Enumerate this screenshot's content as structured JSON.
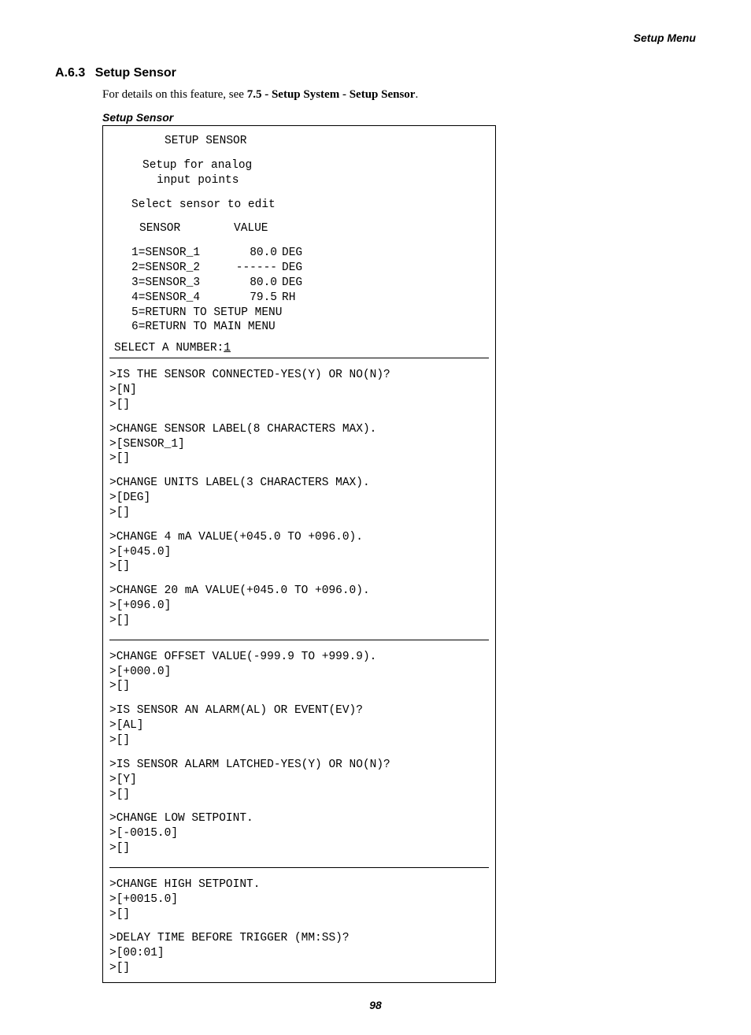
{
  "header": {
    "right": "Setup Menu"
  },
  "section": {
    "number": "A.6.3",
    "title": "Setup Sensor",
    "details_prefix": "For details on this feature, see ",
    "details_ref": "7.5 - Setup System - Setup Sensor",
    "details_suffix": "."
  },
  "box": {
    "label": "Setup Sensor",
    "title": "SETUP SENSOR",
    "subtitle1": "Setup for analog",
    "subtitle2": "input points",
    "select_prompt": "Select sensor to edit",
    "col_sensor": "SENSOR",
    "col_value": "VALUE",
    "sensors": [
      {
        "idx": "1",
        "name": "SENSOR_1",
        "value": "80.0",
        "unit": "DEG"
      },
      {
        "idx": "2",
        "name": "SENSOR_2",
        "value": "------",
        "unit": "DEG"
      },
      {
        "idx": "3",
        "name": "SENSOR_3",
        "value": "80.0",
        "unit": "DEG"
      },
      {
        "idx": "4",
        "name": "SENSOR_4",
        "value": "79.5",
        "unit": "RH"
      }
    ],
    "menu5": "5=RETURN TO SETUP MENU",
    "menu6": "6=RETURN TO MAIN MENU",
    "select_num_label": "SELECT A NUMBER:",
    "select_num_value": "1",
    "prompts": [
      {
        "q": ">IS THE SENSOR CONNECTED-YES(Y) OR NO(N)?",
        "cur": ">[N]",
        "in": ">[]"
      },
      {
        "q": ">CHANGE SENSOR LABEL(8 CHARACTERS MAX).",
        "cur": ">[SENSOR_1]",
        "in": ">[]"
      },
      {
        "q": ">CHANGE UNITS LABEL(3 CHARACTERS MAX).",
        "cur": ">[DEG]",
        "in": ">[]"
      },
      {
        "q": ">CHANGE 4 mA VALUE(+045.0 TO +096.0).",
        "cur": ">[+045.0]",
        "in": ">[]"
      },
      {
        "q": ">CHANGE 20 mA VALUE(+045.0 TO +096.0).",
        "cur": ">[+096.0]",
        "in": ">[]"
      },
      {
        "hr": true
      },
      {
        "q": ">CHANGE OFFSET VALUE(-999.9 TO +999.9).",
        "cur": ">[+000.0]",
        "in": ">[]"
      },
      {
        "q": ">IS SENSOR AN ALARM(AL) OR EVENT(EV)?",
        "cur": ">[AL]",
        "in": ">[]"
      },
      {
        "q": ">IS SENSOR ALARM LATCHED-YES(Y) OR NO(N)?",
        "cur": ">[Y]",
        "in": ">[]"
      },
      {
        "q": ">CHANGE LOW SETPOINT.",
        "cur": ">[-0015.0]",
        "in": ">[]"
      },
      {
        "hr": true
      },
      {
        "q": ">CHANGE HIGH SETPOINT.",
        "cur": ">[+0015.0]",
        "in": ">[]"
      },
      {
        "q": ">DELAY TIME BEFORE TRIGGER (MM:SS)?",
        "cur": ">[00:01]",
        "in": ">[]"
      }
    ]
  },
  "footer": {
    "page": "98"
  }
}
